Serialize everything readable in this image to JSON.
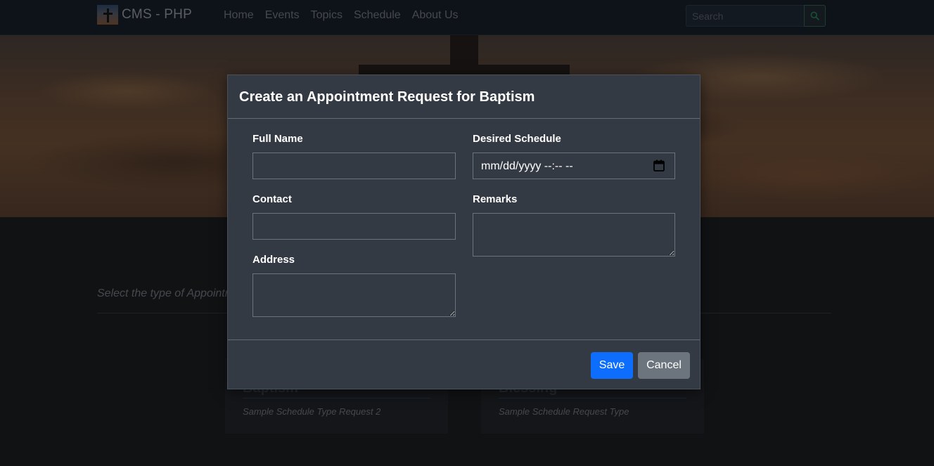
{
  "navbar": {
    "brand": "CMS - PHP",
    "links": [
      "Home",
      "Events",
      "Topics",
      "Schedule",
      "About Us"
    ],
    "search_placeholder": "Search"
  },
  "page": {
    "section_text": "Select the type of Appointment",
    "cards": [
      {
        "title": "Baptism",
        "desc": "Sample Schedule Type Request 2"
      },
      {
        "title": "Blessing",
        "desc": "Sample Schedule Request Type"
      }
    ]
  },
  "modal": {
    "title": "Create an Appointment Request for Baptism",
    "fields": {
      "full_name": {
        "label": "Full Name",
        "value": ""
      },
      "contact": {
        "label": "Contact",
        "value": ""
      },
      "address": {
        "label": "Address",
        "value": ""
      },
      "desired_schedule": {
        "label": "Desired Schedule",
        "value": "mm/dd/yyyy --:-- --"
      },
      "remarks": {
        "label": "Remarks",
        "value": ""
      }
    },
    "save_label": "Save",
    "cancel_label": "Cancel"
  },
  "colors": {
    "primary": "#0d6efd",
    "secondary": "#6c757d",
    "modal_bg": "#343a44",
    "navbar_bg": "#1d2632"
  }
}
